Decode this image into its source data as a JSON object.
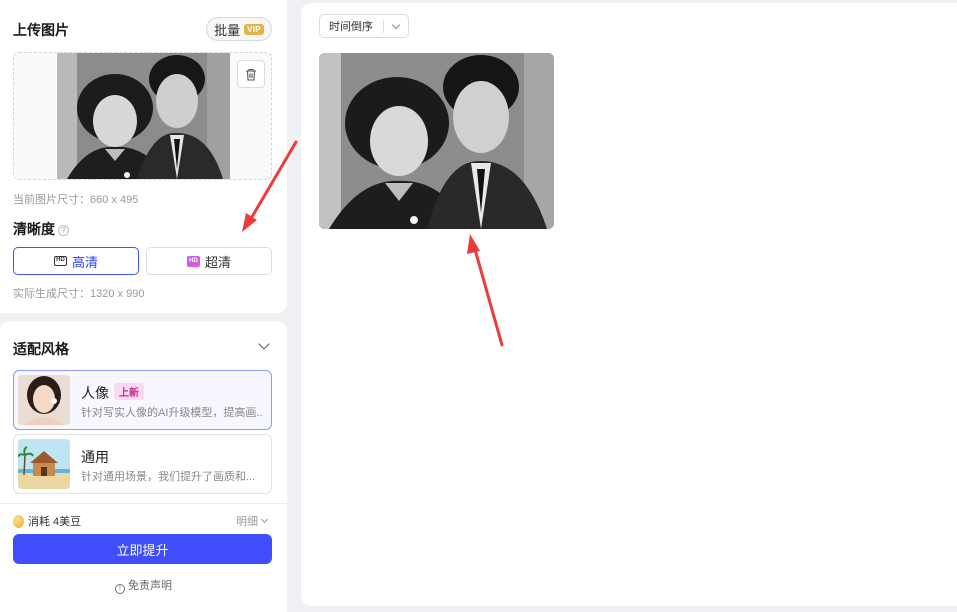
{
  "upload": {
    "title": "上传图片",
    "batch_label": "批量",
    "vip_badge": "VIP",
    "current_size": "当前图片尺寸：660 x 495"
  },
  "clarity": {
    "title": "清晰度",
    "hd_label": "高清",
    "hd_icon": "HD",
    "uhd_label": "超清",
    "uhd_icon": "HD",
    "output_size": "实际生成尺寸：1320 x 990"
  },
  "style": {
    "title": "适配风格",
    "items": [
      {
        "name": "人像",
        "badge": "上新",
        "desc": "针对写实人像的AI升级模型，提高画..."
      },
      {
        "name": "通用",
        "desc": "针对通用场景，我们提升了画质和..."
      }
    ]
  },
  "footer": {
    "cost": "消耗 4美豆",
    "detail": "明细",
    "submit": "立即提升",
    "disclaimer": "免责声明"
  },
  "main": {
    "sort_label": "时间倒序"
  },
  "colors": {
    "primary": "#3f4dfb",
    "annotation_arrow": "#ec3b3b",
    "new_badge": "#fbd9ef"
  }
}
